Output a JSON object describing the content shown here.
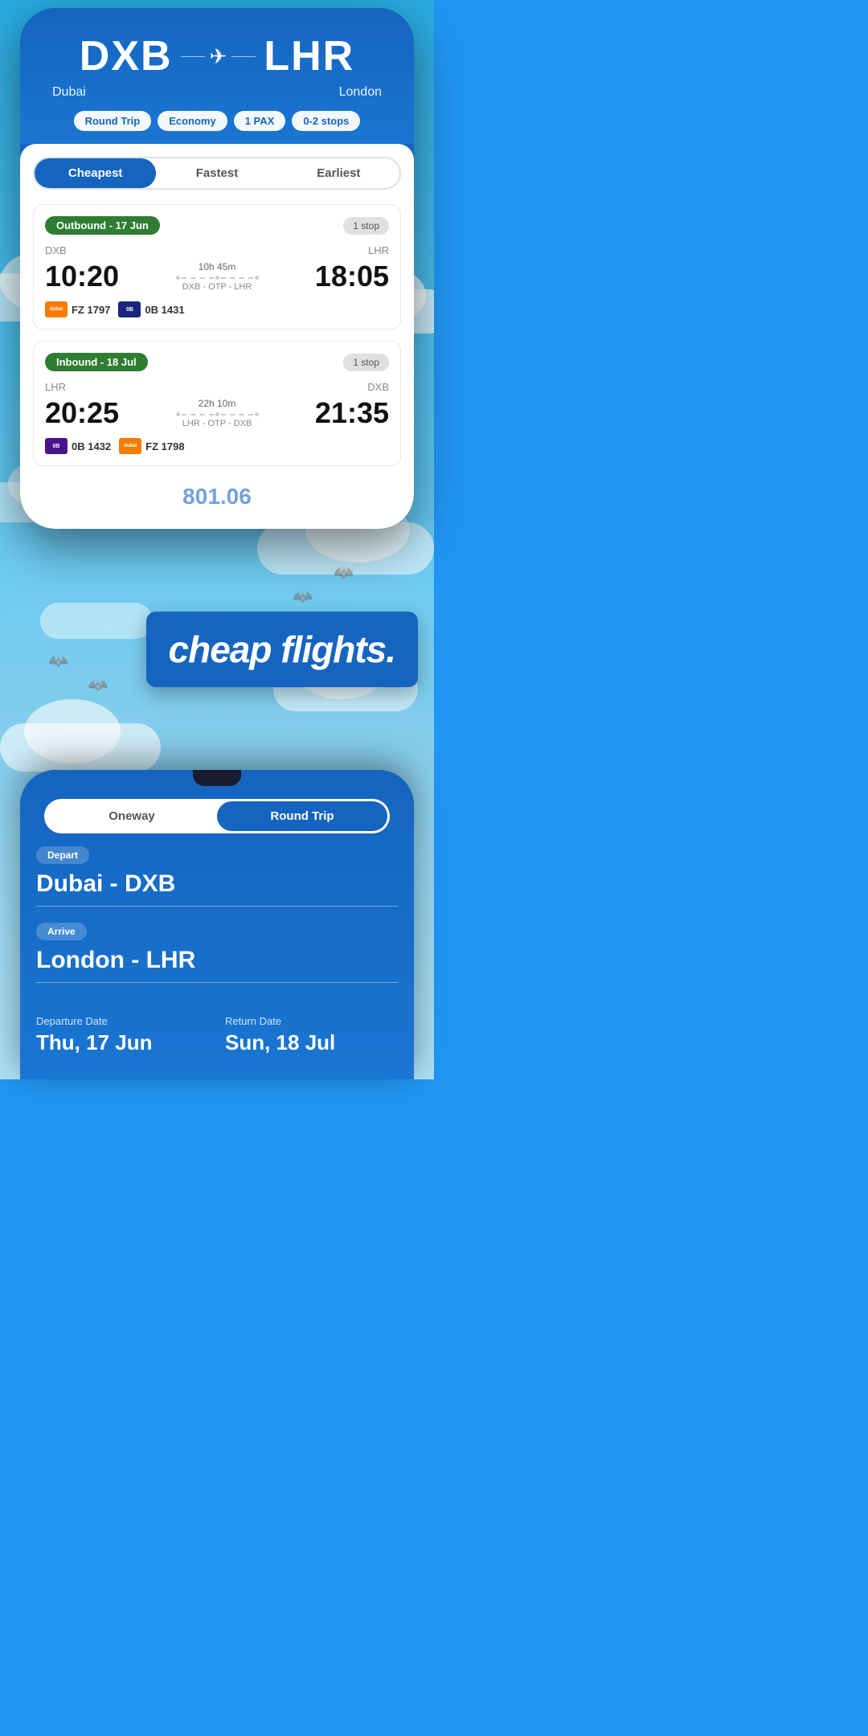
{
  "phone1": {
    "header": {
      "origin_code": "DXB",
      "origin_city": "Dubai",
      "destination_code": "LHR",
      "destination_city": "London",
      "tags": {
        "trip_type": "Round Trip",
        "cabin": "Economy",
        "pax": "1 PAX",
        "stops": "0-2 stops"
      }
    },
    "tabs": {
      "cheapest": "Cheapest",
      "fastest": "Fastest",
      "earliest": "Earliest"
    },
    "outbound": {
      "label": "Outbound - 17 Jun",
      "stop_count": "1 stop",
      "origin": "DXB",
      "destination": "LHR",
      "departure_time": "10:20",
      "arrival_time": "18:05",
      "duration": "10h 45m",
      "route": "DXB - OTP - LHR",
      "airlines": [
        {
          "code": "FZ 1797",
          "color": "orange",
          "label": "dubai"
        },
        {
          "code": "0B 1431",
          "color": "blue",
          "label": "0B"
        }
      ]
    },
    "inbound": {
      "label": "Inbound - 18 Jul",
      "stop_count": "1 stop",
      "origin": "LHR",
      "destination": "DXB",
      "departure_time": "20:25",
      "arrival_time": "21:35",
      "duration": "22h 10m",
      "route": "LHR - OTP - DXB",
      "airlines": [
        {
          "code": "0B 1432",
          "color": "purple",
          "label": "0B"
        },
        {
          "code": "FZ 1798",
          "color": "orange",
          "label": "dubai"
        }
      ]
    },
    "price_peek": "801.06"
  },
  "middle": {
    "tagline": "cheap flights."
  },
  "phone2": {
    "toggle": {
      "oneway": "Oneway",
      "round_trip": "Round Trip"
    },
    "depart_label": "Depart",
    "depart_value": "Dubai - DXB",
    "arrive_label": "Arrive",
    "arrive_value": "London - LHR",
    "departure_date_label": "Departure Date",
    "departure_date_value": "Thu, 17 Jun",
    "return_date_label": "Return Date",
    "return_date_value": "Sun, 18 Jul"
  },
  "icons": {
    "plane": "✈"
  }
}
